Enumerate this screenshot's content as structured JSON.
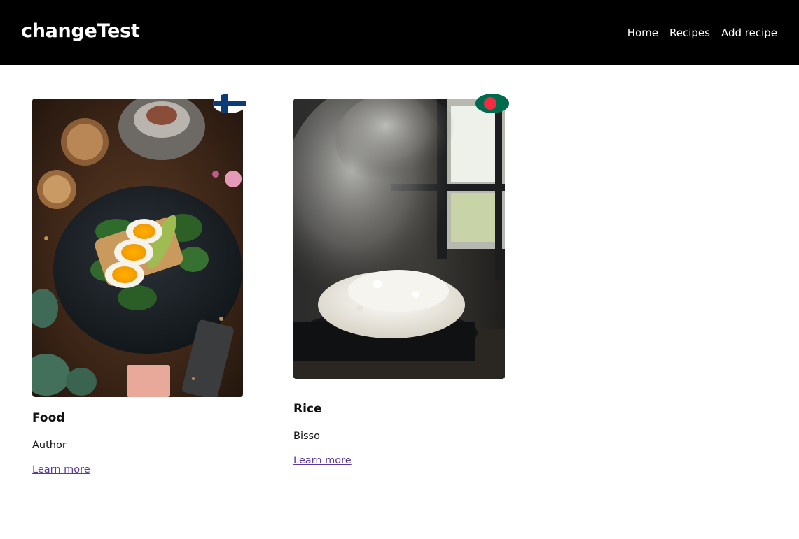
{
  "header": {
    "brand": "changeTest",
    "nav": {
      "home": "Home",
      "recipes": "Recipes",
      "add_recipe": "Add recipe"
    }
  },
  "recipes": [
    {
      "title": "Food",
      "author": "Author",
      "link_label": "Learn more",
      "flag": "finland-flag-icon",
      "image": "egg-avocado-toast-photo"
    },
    {
      "title": "Rice",
      "author": "Bisso",
      "link_label": "Learn more",
      "flag": "bangladesh-flag-icon",
      "image": "steaming-rice-photo"
    }
  ],
  "colors": {
    "header_bg": "#000000",
    "link": "#5b3aa0",
    "finland_blue": "#0f3a7a",
    "bangladesh_green": "#006a4e",
    "bangladesh_red": "#f42a41"
  }
}
